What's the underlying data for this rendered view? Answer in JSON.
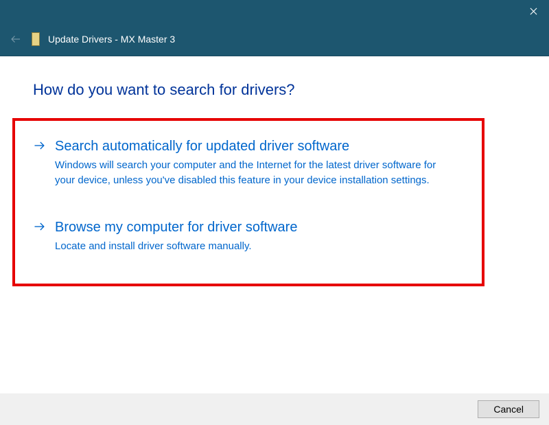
{
  "titlebar": {
    "close": "×"
  },
  "header": {
    "title": "Update Drivers - MX Master 3"
  },
  "main": {
    "heading": "How do you want to search for drivers?"
  },
  "options": [
    {
      "title": "Search automatically for updated driver software",
      "description": "Windows will search your computer and the Internet for the latest driver software for your device, unless you've disabled this feature in your device installation settings."
    },
    {
      "title": "Browse my computer for driver software",
      "description": "Locate and install driver software manually."
    }
  ],
  "footer": {
    "cancel": "Cancel"
  }
}
